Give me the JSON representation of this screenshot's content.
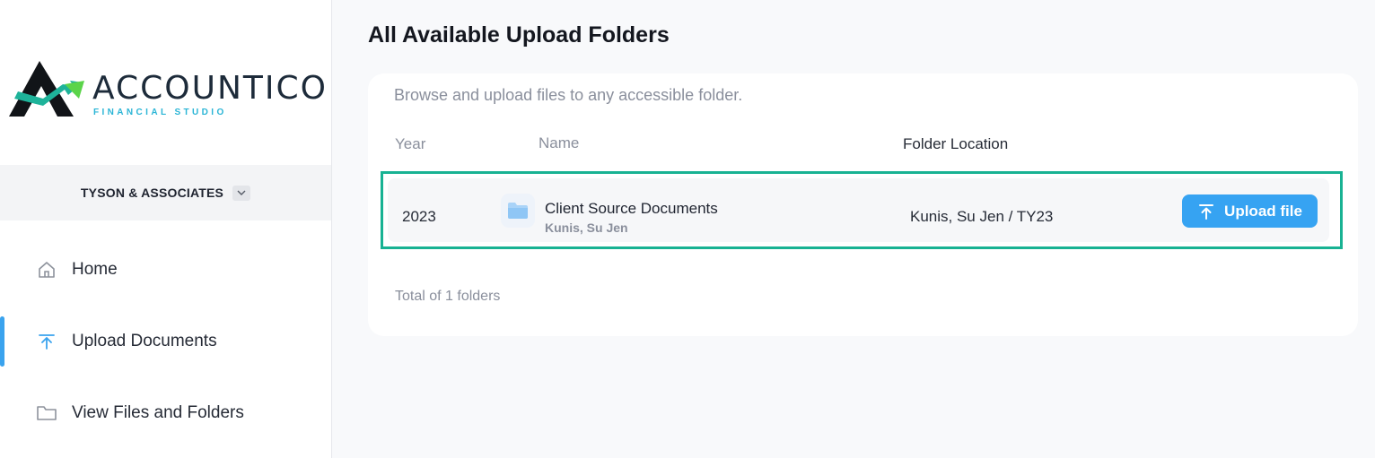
{
  "brand": {
    "name": "ACCOUNTICO",
    "tagline": "FINANCIAL STUDIO",
    "colors": {
      "dark": "#1d2b3a",
      "green": "#18b293",
      "cyan": "#2bb5d6",
      "lime": "#5bd44a"
    }
  },
  "org_switcher": {
    "name": "TYSON & ASSOCIATES",
    "icon": "chevron-down-icon"
  },
  "nav": {
    "items": [
      {
        "label": "Home",
        "icon": "home-icon",
        "active": false
      },
      {
        "label": "Upload Documents",
        "icon": "upload-icon",
        "active": true
      },
      {
        "label": "View Files and Folders",
        "icon": "folder-icon",
        "active": false
      }
    ]
  },
  "main": {
    "title": "All Available Upload Folders",
    "description": "Browse and upload files to any accessible folder.",
    "columns": {
      "year": "Year",
      "name": "Name",
      "location": "Folder Location"
    },
    "rows": [
      {
        "year": "2023",
        "name": "Client Source Documents",
        "owner": "Kunis, Su Jen",
        "location": "Kunis, Su Jen / TY23",
        "action": "Upload file"
      }
    ],
    "total": "Total of 1 folders"
  },
  "colors": {
    "accent": "#36a3f2",
    "highlight": "#18b293"
  }
}
